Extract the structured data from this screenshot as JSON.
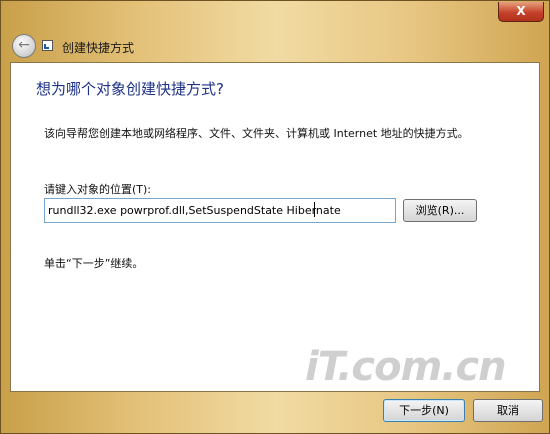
{
  "window": {
    "close_label": "X"
  },
  "wizard": {
    "title": "创建快捷方式",
    "heading": "想为哪个对象创建快捷方式?",
    "description": "该向导帮您创建本地或网络程序、文件、文件夹、计算机或 Internet 地址的快捷方式。",
    "location_label": "请键入对象的位置(T):",
    "location_value": "rundll32.exe powrprof.dll,SetSuspendState Hibernate",
    "browse_label": "浏览(R)...",
    "hint": "单击“下一步”继续。",
    "next_label": "下一步(N)",
    "cancel_label": "取消"
  },
  "watermark": {
    "text": "iT.com.cn"
  },
  "icons": {
    "back": "back-arrow-icon",
    "wizard": "shortcut-icon"
  }
}
